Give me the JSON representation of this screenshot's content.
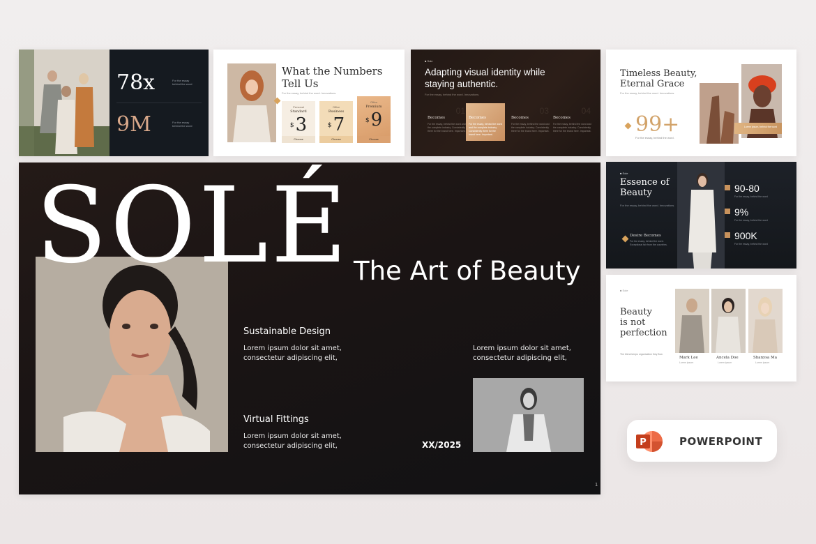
{
  "slide1": {
    "stat1": "78x",
    "stat1_caption": "For the essay behind the word",
    "stat2": "9M",
    "stat2_caption": "For the essay behind the word"
  },
  "slide2": {
    "title_line1": "What the Numbers",
    "title_line2": "Tell Us",
    "subtitle": "For the essay, behind the word. Innovations.",
    "cards": [
      {
        "tier": "Personal",
        "name": "Standard",
        "currency": "$",
        "price": "3",
        "cta": "Choose"
      },
      {
        "tier": "Office",
        "name": "Business",
        "currency": "$",
        "price": "7",
        "cta": "Choose"
      },
      {
        "tier": "Office",
        "name": "Premium",
        "currency": "$",
        "price": "9",
        "cta": "Choose"
      }
    ]
  },
  "slide3": {
    "brand": "■ Sole",
    "title_line1": "Adapting visual identity while",
    "title_line2": "staying authentic.",
    "subtitle": "For the essay, behind the word. Innovations.",
    "columns": [
      {
        "num": "01",
        "heading": "Becomes",
        "text": "For the essay, behind the word and the complete industry. Consistently there for the brand here. Important."
      },
      {
        "num": "02",
        "heading": "Becomes",
        "text": "For the essay, behind the word and the complete industry. Consistently there for the brand here. Important."
      },
      {
        "num": "03",
        "heading": "Becomes",
        "text": "For the essay, behind the word and the complete industry. Consistently there for the brand here. Important."
      },
      {
        "num": "04",
        "heading": "Becomes",
        "text": "For the essay, behind the word and the complete industry. Consistently there for the brand here. Important."
      }
    ]
  },
  "slide4": {
    "title_line1": "Timeless Beauty,",
    "title_line2": "Eternal Grace",
    "subtitle": "For the essay, behind the word. Innovations.",
    "stat": "99+",
    "stat_caption": "For the essay, behind the word.",
    "tag": "Lorem ipsum, behind the word"
  },
  "main": {
    "logo": "SOLÉ",
    "tagline": "The Art of Beauty",
    "section1_heading": "Sustainable Design",
    "section1_line1": "Lorem ipsum dolor sit amet,",
    "section1_line2": "consectetur adipiscing elit,",
    "section2_heading": "Virtual Fittings",
    "section2_line1": "Lorem ipsum dolor sit amet,",
    "section2_line2": "consectetur adipiscing elit,",
    "section3_line1": "Lorem ipsum dolor sit amet,",
    "section3_line2": "consectetur adipiscing elit,",
    "date": "XX/2025",
    "page": "1"
  },
  "slide5": {
    "brand": "■ Sole",
    "title_line1": "Essence of",
    "title_line2": "Beauty",
    "subtitle": "For the essay, behind the word. Innovations.",
    "desire_heading": "Desire Becomes",
    "desire_text": "For the essay, behind the word. Exceptional fair from the countries.",
    "stats": [
      {
        "value": "90-80",
        "caption": "For the essay, behind the word"
      },
      {
        "value": "9%",
        "caption": "For the essay, behind the word"
      },
      {
        "value": "900K",
        "caption": "For the essay, behind the word"
      }
    ]
  },
  "slide6": {
    "brand": "■ Sole",
    "title_line1": "Beauty",
    "title_line2": "is not",
    "title_line3": "perfection",
    "subtitle": "The blend keeps organization they flow.",
    "people": [
      {
        "name": "Mark Lee",
        "role": "Lorem ipsum"
      },
      {
        "name": "Ancela Doe",
        "role": "Lorem ipsum"
      },
      {
        "name": "Shanysa Ma",
        "role": "Lorem ipsum"
      }
    ]
  },
  "badge": {
    "label": "POWERPOINT",
    "icon": "powerpoint-icon",
    "colors": {
      "accent": "#d24726",
      "accent_light": "#ff8f6b"
    }
  },
  "colors": {
    "gold": "#d2a36a",
    "copper": "#c8925c",
    "dark": "#1a1414"
  }
}
